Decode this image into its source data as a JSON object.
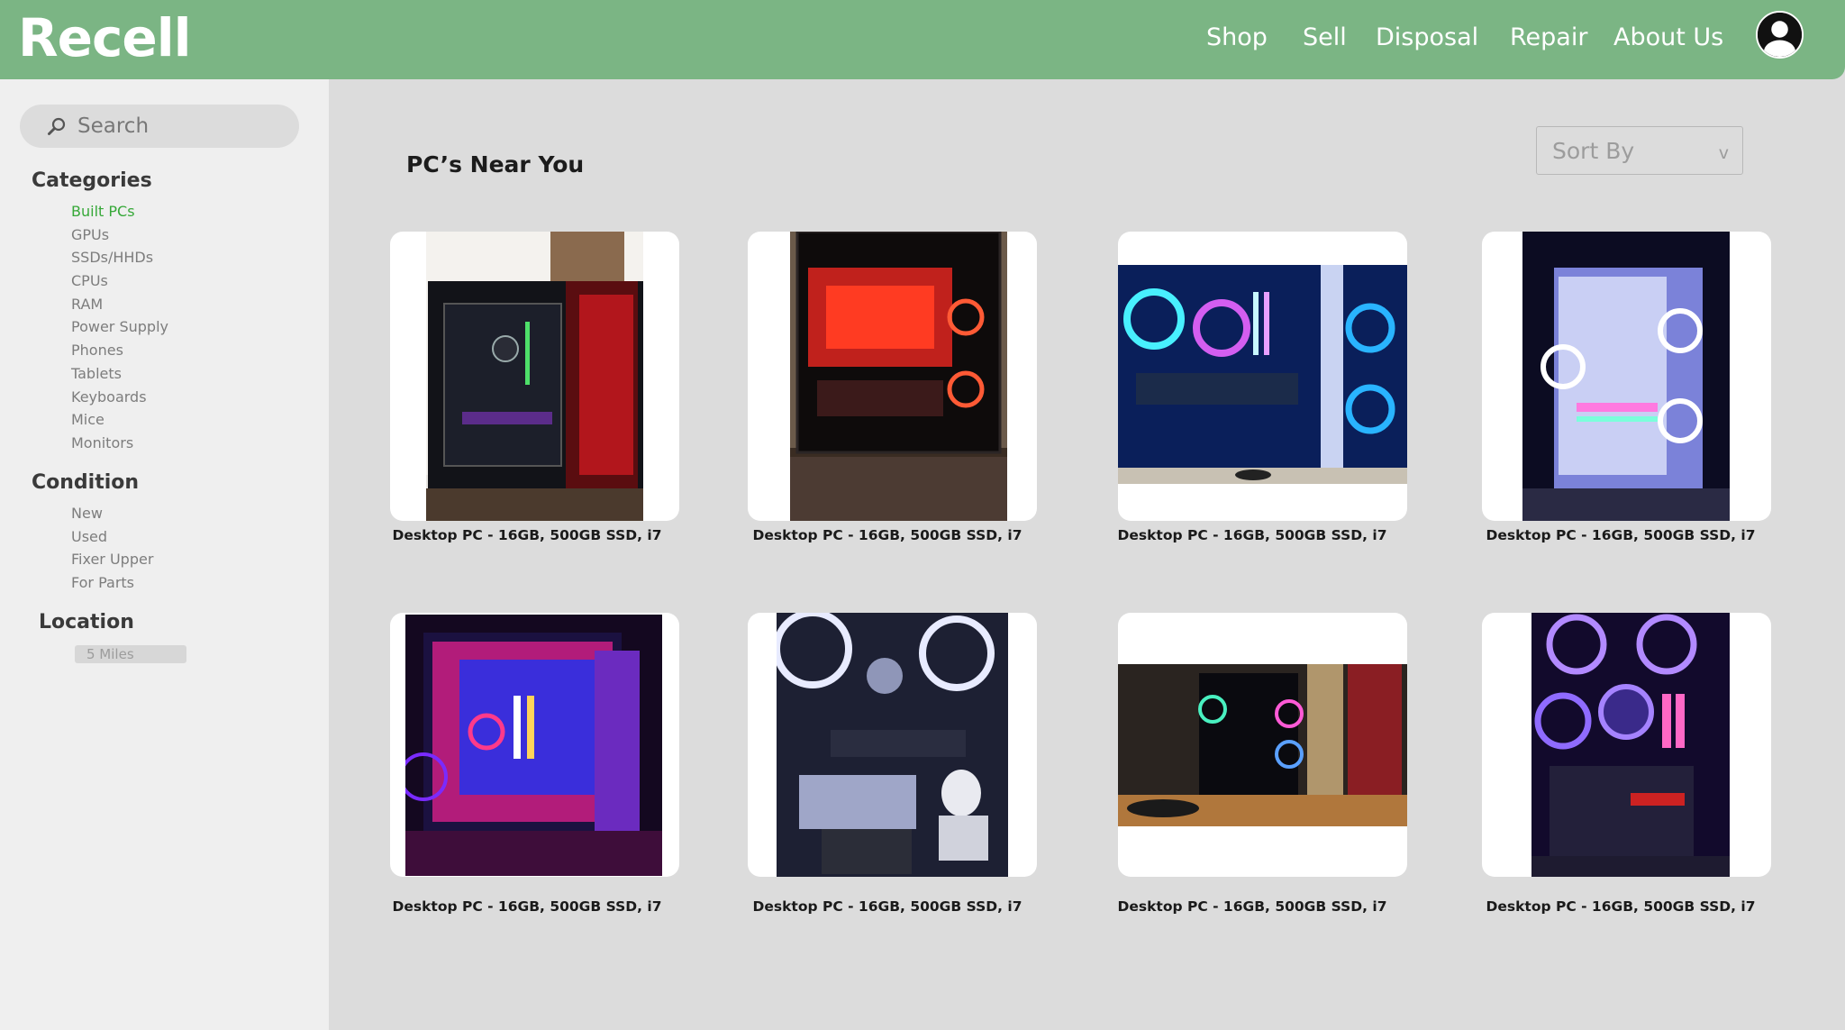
{
  "header": {
    "logo": "Recell",
    "nav": [
      "Shop",
      "Sell",
      "Disposal",
      "Repair",
      "About Us"
    ]
  },
  "sidebar": {
    "search_placeholder": "Search",
    "categories": {
      "title": "Categories",
      "items": [
        "Built PCs",
        "GPUs",
        "SSDs/HHDs",
        "CPUs",
        "RAM",
        "Power Supply",
        "Phones",
        "Tablets",
        "Keyboards",
        "Mice",
        "Monitors"
      ],
      "active": "Built PCs"
    },
    "condition": {
      "title": "Condition",
      "items": [
        "New",
        "Used",
        "Fixer Upper",
        "For Parts"
      ]
    },
    "location": {
      "title": "Location",
      "value": "5 Miles"
    }
  },
  "main": {
    "title": "PC’s Near You",
    "sort_label": "Sort By",
    "sort_chevron": "v",
    "products": [
      {
        "title": "Desktop PC - 16GB, 500GB SSD, i7"
      },
      {
        "title": "Desktop PC - 16GB, 500GB SSD, i7"
      },
      {
        "title": "Desktop PC - 16GB, 500GB SSD, i7"
      },
      {
        "title": "Desktop PC - 16GB, 500GB SSD, i7"
      },
      {
        "title": "Desktop PC - 16GB, 500GB SSD, i7"
      },
      {
        "title": "Desktop PC - 16GB, 500GB SSD, i7"
      },
      {
        "title": "Desktop PC - 16GB, 500GB SSD, i7"
      },
      {
        "title": "Desktop PC - 16GB, 500GB SSD, i7"
      }
    ]
  },
  "colors": {
    "header_bg": "#7bb584",
    "active_category": "#36a838",
    "page_bg": "#dcdcdc",
    "sidebar_bg": "#efefef"
  },
  "icons": {
    "search": "magnifier-icon",
    "account": "user-avatar-icon",
    "sort": "chevron-down-icon"
  }
}
